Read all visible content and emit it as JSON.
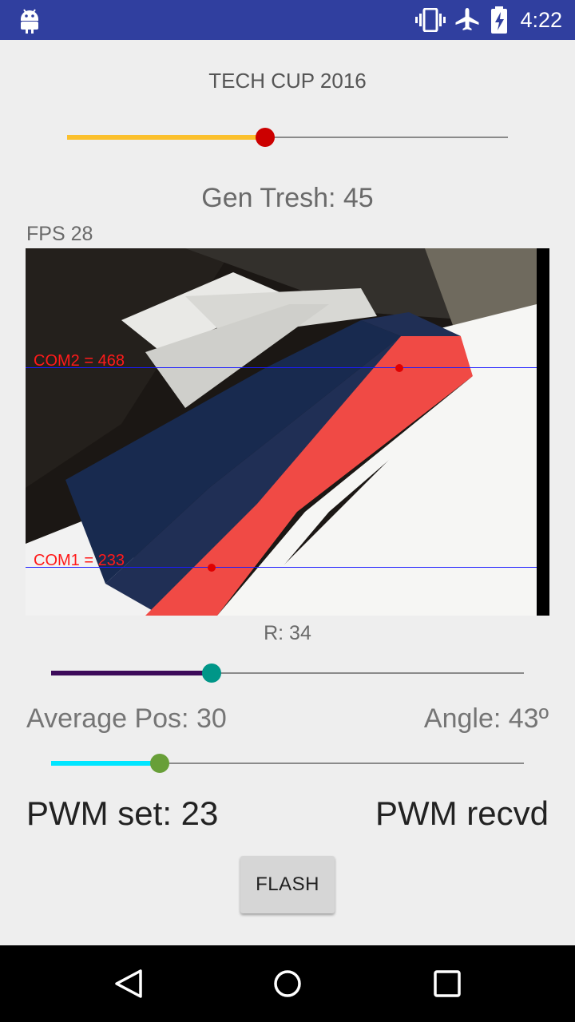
{
  "status_bar": {
    "time": "4:22",
    "icons": [
      "android-icon",
      "vibrate-icon",
      "airplane-icon",
      "battery-charging-icon"
    ]
  },
  "title": "TECH CUP 2016",
  "gen_tresh": {
    "label": "Gen Tresh: 45",
    "slider_fraction": 0.45,
    "fill_color": "#fbc02d",
    "thumb_color": "#cc0000"
  },
  "fps": "FPS 28",
  "camera": {
    "com2_label": "COM2 = 468",
    "com1_label": "COM1 = 233"
  },
  "r": {
    "label": "R: 34",
    "slider_fraction": 0.34,
    "fill_color": "#3c0a5a",
    "thumb_color": "#009688"
  },
  "average_pos": "Average Pos: 30",
  "angle": "Angle: 43º",
  "pos_slider": {
    "slider_fraction": 0.23,
    "fill_color": "#00e5ff",
    "thumb_color": "#689f38"
  },
  "pwm_set": "PWM set: 23",
  "pwm_recvd": "PWM recvd",
  "flash_button": "FLASH",
  "nav": [
    "back-icon",
    "home-icon",
    "recents-icon"
  ]
}
